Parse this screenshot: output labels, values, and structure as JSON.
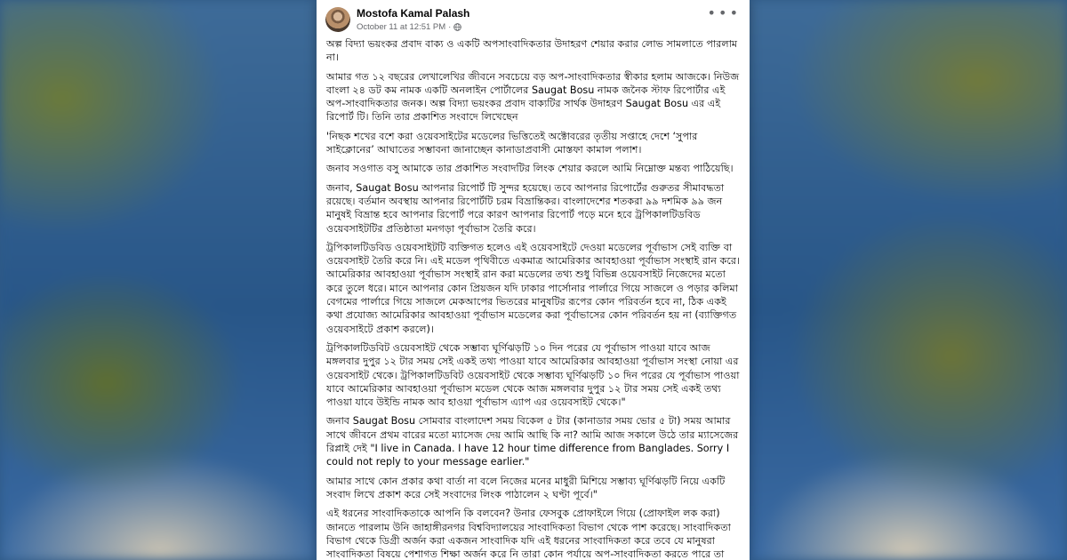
{
  "post": {
    "author": "Mostofa Kamal Palash",
    "timestamp": "October 11 at 12:51 PM",
    "privacy_icon": "globe-icon",
    "more_icon": "more-options-icon",
    "paragraphs": [
      "অল্প বিদ্যা ভয়ংকর প্রবাদ বাক্য ও একটি অপসাংবাদিকতার উদাহরণ শেয়ার করার লোভ সামলাতে পারলাম না।",
      "আমার গত ১২ বছরের লেখালেখির জীবনে সবচেয়ে বড় অপ-সাংবাদিকতার স্বীকার হলাম আজকে। নিউজ বাংলা ২৪ ডট কম নামক একটি অনলাইন পোর্টালের Saugat Bosu নামক জনৈক স্টাফ রিপোর্টার এই অপ-সাংবাদিকতার জনক। অল্প বিদ্যা ভয়ংকর প্রবাদ বাক্যটির সার্থক উদাহরণ Saugat Bosu এর এই রিপোর্ট টি। তিনি তার প্রকাশিত সংবাদে লিখেছেন",
      "'নিছক শখের বশে করা ওয়েবসাইটের মডেলের ভিত্তিতেই অক্টোবরের তৃতীয় সপ্তাহে দেশে ‘সুপার সাইক্লোনের’ আঘাতের সম্ভাবনা জানাচ্ছেন কানাডাপ্রবাসী মোস্তফা কামাল পলাশ।",
      "জনাব সওগাত বসু আমাকে তার প্রকাশিত সংবাদটির লিংক শেয়ার করলে আমি নিম্নোক্ত মন্তব্য পাঠিয়েছি।",
      "জনাব, Saugat Bosu আপনার রিপোর্ট টি সুন্দর হয়েছে। তবে আপনার রিপোর্টের গুরুতর সীমাবদ্ধতা রয়েছে। বর্তমান অবস্থায় আপনার রিপোর্টটি চরম বিভ্রান্তিকর। বাংলাদেশের শতকরা ৯৯ দশমিক ৯৯ জন মানুষই বিভ্রান্ত হবে আপনার রিপোর্ট পরে কারণ আপনার রিপোর্ট পড়ে মনে হবে ট্রপিকালটিডবিড ওয়েবসাইটটির প্রতিষ্ঠাতা মনগড়া পূর্বাভাস তৈরি করে।",
      "ট্রপিকালটিডবিড ওয়েবসাইটটি ব্যক্তিগত হলেও এই ওয়েবসাইটে দেওয়া মডেলের পূর্বাভাস সেই ব্যক্তি বা ওয়েবসাইট তৈরি করে নি। এই মডেল পৃথিবীতে একমাত্র আমেরিকার আবহাওয়া পূর্বাভাস সংস্থাই রান করে। আমেরিকার আবহাওয়া পূর্বাভাস সংস্থাই রান করা মডেলের তথ্য শুধু বিভিন্ন ওয়েবসাইট নিজেদের মতো করে তুলে ধরে। মানে আপনার কোন প্রিয়জন যদি ঢাকার পার্সোনার পার্লারে গিয়ে সাজলে ও পড়ার কলিমা বেগমের পার্লারে গিয়ে সাজলে মেকআপের ভিতরের মানুষটির রূপের কোন পরিবর্তন হবে না, ঠিক একই কথা প্রযোজ্য আমেরিকার আবহাওয়া পূর্বাভাস মডেলের করা পূর্বাভাসের কোন পরিবর্তন হয় না (ব্যাক্তিগত ওয়েবসাইটে প্রকাশ করলে)।",
      "ট্রপিকালটিডবিট ওয়েবসাইট থেকে সম্ভাব্য ঘূর্ণিঝড়টি ১০ দিন পরের যে পূর্বাভাস পাওয়া যাবে আজ মঙ্গলবার দুপুর ১২ টার সময় সেই একই তথ্য পাওয়া যাবে আমেরিকার আবহাওয়া পূর্বাভাস সংস্থা নোয়া এর ওয়েবসাইট থেকে। ট্রপিকালটিডবিট ওয়েবসাইট থেকে সম্ভাব্য ঘূর্ণিঝড়টি ১০ দিন পরের যে পূর্বাভাস পাওয়া যাবে আমেরিকার আবহাওয়া পূর্বাভাস মডেল থেকে আজ মঙ্গলবার দুপুর ১২ টার সময় সেই একই তথ্য পাওয়া যাবে উইন্ডি নামক আব হাওয়া পূর্বাভাস এ্যাপ এর ওয়েবসাইট থেকে।\"",
      "জনাব Saugat Bosu সোমবার বাংলাদেশ সময় বিকেল ৫ টার (কানাডার সময় ভোর ৫ টা) সময় আমার সাথে জীবনে প্রথম বারের মতো ম্যাসেজ দেয় আমি আছি কি না? আমি আজ সকালে উঠে তার ম্যাসেজের রিপ্লাই দেই \"I live in Canada. I have 12 hour time difference from Banglades. Sorry I could not reply to your message earlier.\"",
      "আমার সাথে কোন প্রকার কথা বার্তা না বলে নিজের মনের মাধুরী মিশিয়ে সম্ভাব্য ঘূর্ণিঝড়টি নিয়ে একটি সংবাদ লিখে প্রকাশ করে সেই সংবাদের লিংক পাঠালেন ২ ঘণ্টা পূর্বে।\"",
      "এই ধরনের সাংবাদিকতাকে আপনি কি বলবেন? উনার ফেসবুক প্রোফাইলে গিয়ে (প্রোফাইল লক করা) জানতে পারলাম উনি জাহাঙ্গীরনগর বিশ্ববিদ্যালয়ের সাংবাদিকতা বিভাগ থেকে পাশ করেছে। সাংবাদিকতা বিভাগ থেকে ডিগ্রী অর্জন করা একজন সাংবাদিক যদি এই ধরনের সাংবাদিকতা করে তবে যে মানুষরা সাংবাদিকতা বিষয়ে পেশাগত শিক্ষা অর্জন করে নি তারা কোন পর্যায়ে অপ-সাংবাদিকতা করতে পারে তা ভেবেই আমার আক্কেল গুড়ুম হওয়ার অবস্থা।"
    ]
  }
}
